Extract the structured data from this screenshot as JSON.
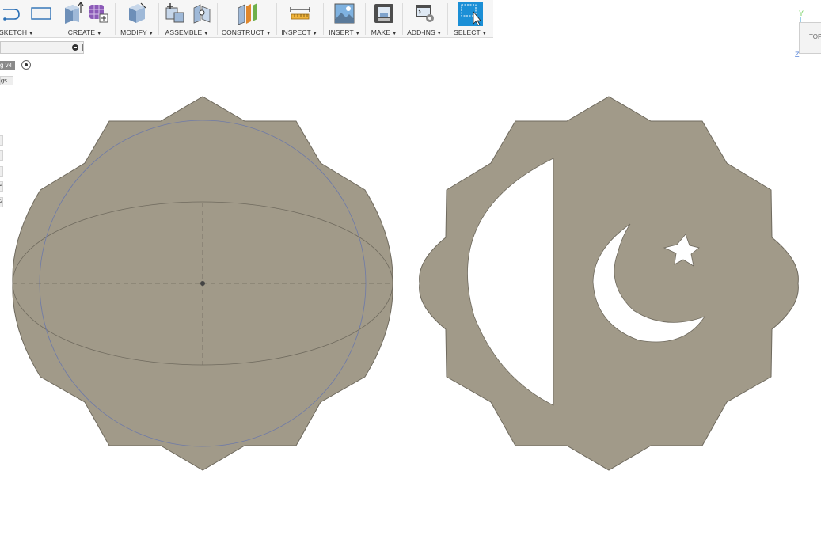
{
  "toolbar": {
    "groups": [
      {
        "label": "SKETCH"
      },
      {
        "label": "CREATE"
      },
      {
        "label": "MODIFY"
      },
      {
        "label": "ASSEMBLE"
      },
      {
        "label": "CONSTRUCT"
      },
      {
        "label": "INSPECT"
      },
      {
        "label": "INSERT"
      },
      {
        "label": "MAKE"
      },
      {
        "label": "ADD-INS"
      },
      {
        "label": "SELECT"
      }
    ],
    "caret": "▼"
  },
  "browser": {
    "document_tag": "g v4",
    "settings_tag": "gs",
    "side_buttons": [
      "",
      "",
      "",
      "4",
      "2"
    ]
  },
  "viewcube": {
    "face_label": "TOP",
    "axis_y": "Y",
    "axis_z": "Z"
  },
  "colors": {
    "shape_fill": "#a19a89",
    "shape_stroke": "#6f6a5e",
    "select_accent": "#1b8fd6",
    "sketch_line": "#6e7aa8"
  },
  "icons": [
    "sketch-line-icon",
    "sketch-rectangle-icon",
    "extrude-icon",
    "form-icon",
    "press-pull-icon",
    "new-component-icon",
    "joint-icon",
    "plane-icon",
    "measure-icon",
    "canvas-icon",
    "3d-print-icon",
    "scripts-icon",
    "select-icon"
  ]
}
